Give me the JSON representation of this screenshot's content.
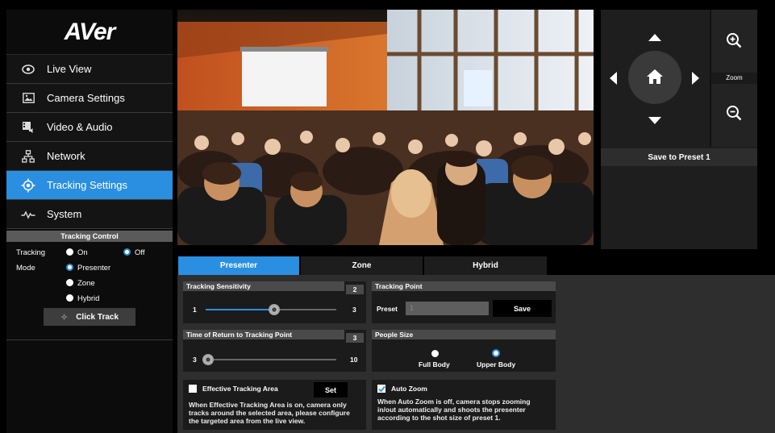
{
  "brand": {
    "logo": "AVer"
  },
  "nav": {
    "items": [
      {
        "label": "Live View",
        "icon": "eye-icon"
      },
      {
        "label": "Camera Settings",
        "icon": "image-icon"
      },
      {
        "label": "Video & Audio",
        "icon": "video-audio-icon"
      },
      {
        "label": "Network",
        "icon": "network-icon"
      },
      {
        "label": "Tracking Settings",
        "icon": "crosshair-icon"
      },
      {
        "label": "System",
        "icon": "pulse-icon"
      }
    ],
    "active_index": 4
  },
  "tracking_control": {
    "header": "Tracking Control",
    "tracking_label": "Tracking",
    "on_label": "On",
    "off_label": "Off",
    "tracking_selected": "Off",
    "mode_label": "Mode",
    "modes": [
      "Presenter",
      "Zone",
      "Hybrid"
    ],
    "mode_selected": "Presenter",
    "click_track_label": "Click Track"
  },
  "camera_control": {
    "zoom_label": "Zoom",
    "save_preset_label": "Save to Preset 1"
  },
  "tabs": {
    "items": [
      "Presenter",
      "Zone",
      "Hybrid"
    ],
    "active": "Presenter"
  },
  "presenter": {
    "sensitivity": {
      "title": "Tracking Sensitivity",
      "value": "2",
      "min": "1",
      "max": "3"
    },
    "return_time": {
      "title": "Time of Return to Tracking Point",
      "value": "3",
      "min": "3",
      "max": "10"
    },
    "tracking_point": {
      "title": "Tracking Point",
      "preset_label": "Preset",
      "preset_value": "1",
      "save_label": "Save"
    },
    "people_size": {
      "title": "People Size",
      "options": [
        "Full Body",
        "Upper Body"
      ],
      "selected": "Upper Body"
    },
    "effective_area": {
      "label": "Effective Tracking Area",
      "checked": false,
      "set_label": "Set",
      "description": "When Effective Tracking Area is on, camera only tracks around the selected area, please configure the targeted area from the live view."
    },
    "auto_zoom": {
      "label": "Auto Zoom",
      "checked": true,
      "description": "When Auto Zoom is off, camera stops zooming in/out automatically and shoots the presenter according to the shot size of preset 1."
    }
  },
  "colors": {
    "accent": "#2a8fe0",
    "panel": "#2e2e2e",
    "sidebar": "#141414"
  }
}
